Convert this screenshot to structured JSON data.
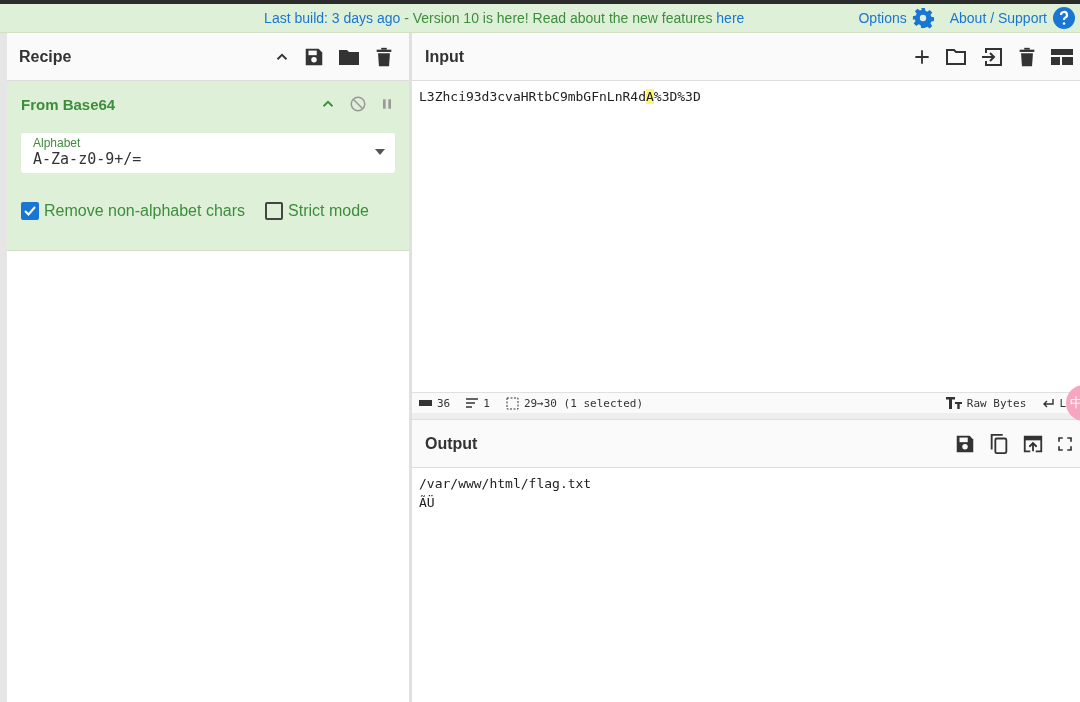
{
  "banner": {
    "segments": [
      {
        "text": "Last build: 3 days ago",
        "kind": "link"
      },
      {
        "text": " - Version 10 is here! Read about the new features ",
        "kind": "plain"
      },
      {
        "text": "here",
        "kind": "link"
      }
    ],
    "links": [
      {
        "label": "Options"
      },
      {
        "label": "About / Support"
      }
    ]
  },
  "recipe": {
    "title": "Recipe",
    "operations": [
      {
        "name": "From Base64",
        "field": {
          "label": "Alphabet",
          "value": "A-Za-z0-9+/="
        },
        "options": [
          {
            "label": "Remove non-alphabet chars",
            "checked": true
          },
          {
            "label": "Strict mode",
            "checked": false
          }
        ]
      }
    ]
  },
  "input": {
    "title": "Input",
    "parts": [
      {
        "text": "L3Zhci93d3cvaHRtbC9mbGFnLnR4d",
        "selected": false
      },
      {
        "text": "A",
        "selected": true
      },
      {
        "text": "%3D%3D",
        "selected": false
      }
    ],
    "status": {
      "length": "36",
      "lines": "1",
      "selection": "29→30 (1 selected)",
      "encoding": "Raw Bytes",
      "eol": "L"
    },
    "ime_badge": "中"
  },
  "output": {
    "title": "Output",
    "lines": [
      "/var/www/html/flag.txt",
      "ÃÜ"
    ]
  }
}
